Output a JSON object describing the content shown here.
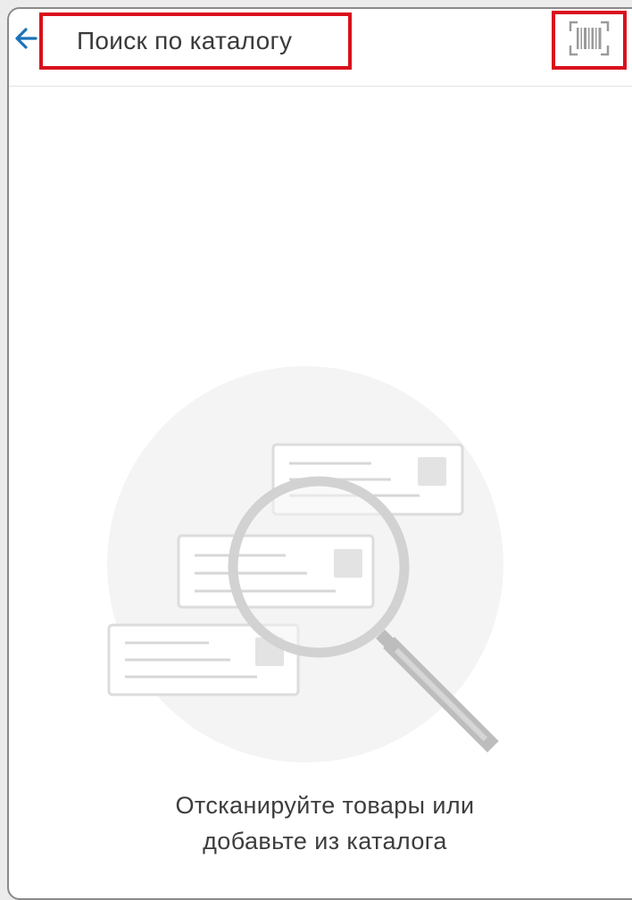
{
  "header": {
    "back_icon": "arrow-left-icon",
    "search_text": "Поиск по каталогу",
    "scan_icon": "barcode-scan-icon"
  },
  "empty_state": {
    "illustration_icon": "magnifier-over-cards-icon",
    "line1": "Отсканируйте товары или",
    "line2": "добавьте из каталога"
  },
  "colors": {
    "accent_back": "#1a73b8",
    "highlight_border": "#d9101d",
    "icon_gray": "#9a9a9a"
  }
}
